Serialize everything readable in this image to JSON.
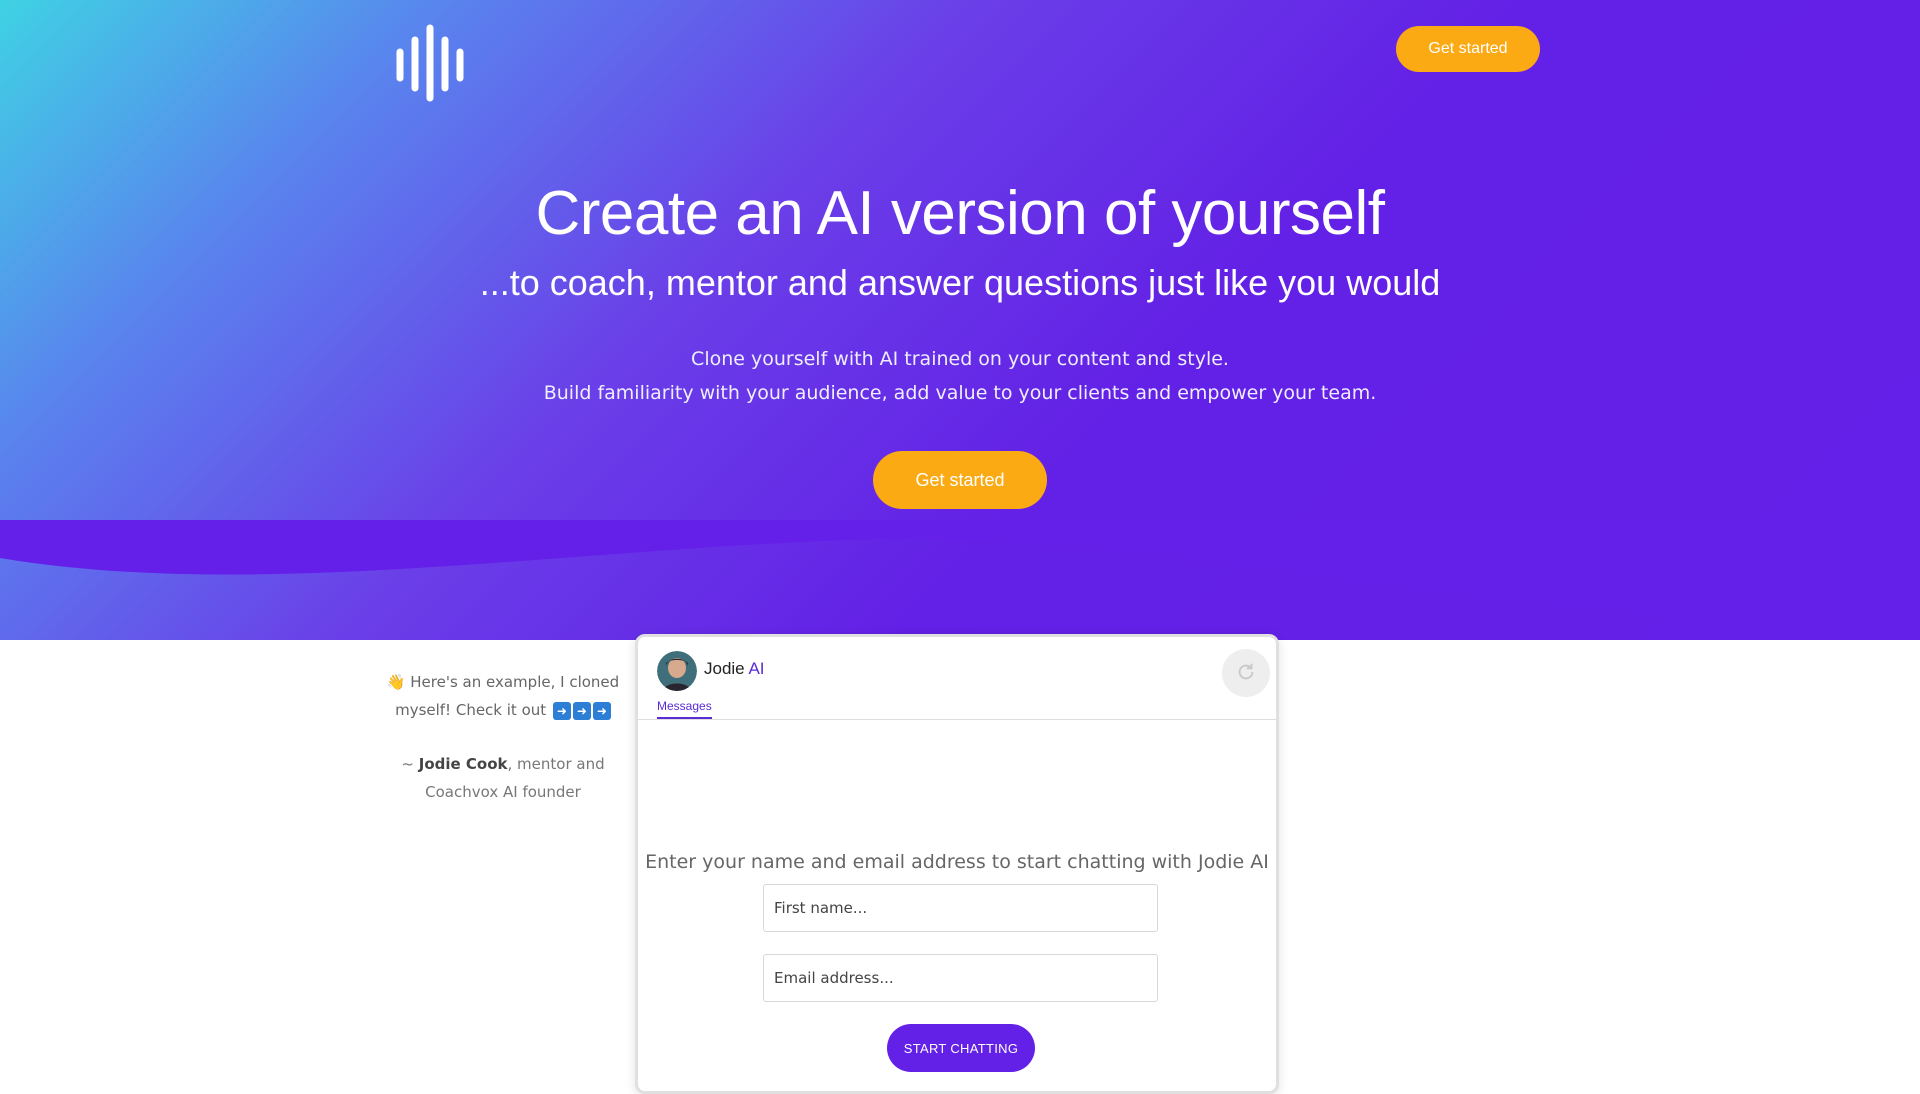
{
  "nav": {
    "cta_label": "Get started",
    "logo_icon": "sound-wave-logo-icon"
  },
  "hero": {
    "headline": "Create an AI version of yourself",
    "subheadline": "...to coach, mentor and answer questions just like you would",
    "description_line1": "Clone yourself with AI trained on your content and style.",
    "description_line2": "Build familiarity with your audience, add value to your clients and empower your team.",
    "cta_label": "Get started"
  },
  "example": {
    "quote_emoji": "👋",
    "quote_text": "Here's an example, I cloned myself! Check it out",
    "arrows": [
      "➡️",
      "➡️",
      "➡️"
    ],
    "attribution_prefix": "~ ",
    "attribution_name": "Jodie Cook",
    "attribution_role": ", mentor and Coachvox AI founder"
  },
  "chat_widget": {
    "bot_name": "Jodie",
    "bot_suffix": "AI",
    "tab_label": "Messages",
    "prompt": "Enter your name and email address to start chatting with Jodie AI",
    "first_name_placeholder": "First name...",
    "email_placeholder": "Email address...",
    "start_label": "START CHATTING",
    "refresh_icon": "refresh-icon"
  },
  "colors": {
    "accent": "#fbaa14",
    "brand_purple": "#6320e6",
    "gradient_start": "#3fd2e4"
  }
}
